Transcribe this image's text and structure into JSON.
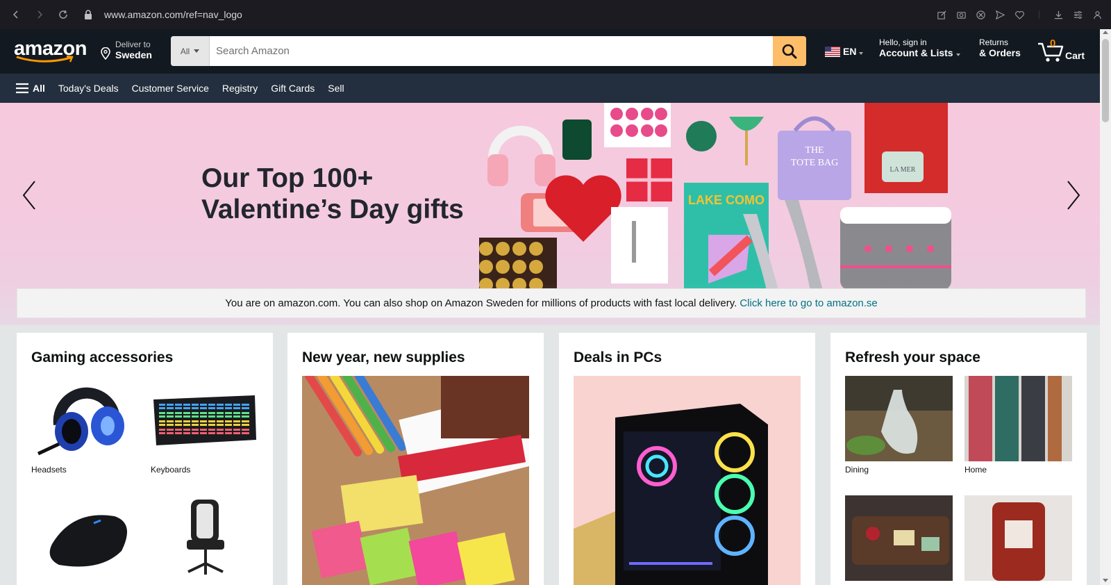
{
  "browser": {
    "url": "www.amazon.com/ref=nav_logo"
  },
  "header": {
    "logo_text": "amazon",
    "deliver_line1": "Deliver to",
    "deliver_line2": "Sweden",
    "search_category": "All",
    "search_placeholder": "Search Amazon",
    "language": "EN",
    "account_line1": "Hello, sign in",
    "account_line2": "Account & Lists",
    "returns_line1": "Returns",
    "returns_line2": "& Orders",
    "cart_count": "0",
    "cart_label": "Cart"
  },
  "subnav": {
    "all_label": "All",
    "items": [
      "Today's Deals",
      "Customer Service",
      "Registry",
      "Gift Cards",
      "Sell"
    ]
  },
  "hero": {
    "title_line1": "Our Top 100+",
    "title_line2": "Valentine’s Day gifts",
    "gift_labels": {
      "tote": "THE TOTE BAG",
      "book": "LAKE COMO",
      "jar": "LA MER"
    }
  },
  "notice": {
    "text": "You are on amazon.com. You can also shop on Amazon Sweden for millions of products with fast local delivery.",
    "link": "Click here to go to amazon.se"
  },
  "cards": [
    {
      "title": "Gaming accessories",
      "items": [
        "Headsets",
        "Keyboards",
        "",
        ""
      ]
    },
    {
      "title": "New year, new supplies"
    },
    {
      "title": "Deals in PCs"
    },
    {
      "title": "Refresh your space",
      "items": [
        "Dining",
        "Home",
        "",
        ""
      ]
    }
  ],
  "colors": {
    "header_bg": "#131921",
    "subnav_bg": "#232f3e",
    "search_button": "#febd69",
    "cart_count": "#f08804",
    "link": "#007185"
  }
}
